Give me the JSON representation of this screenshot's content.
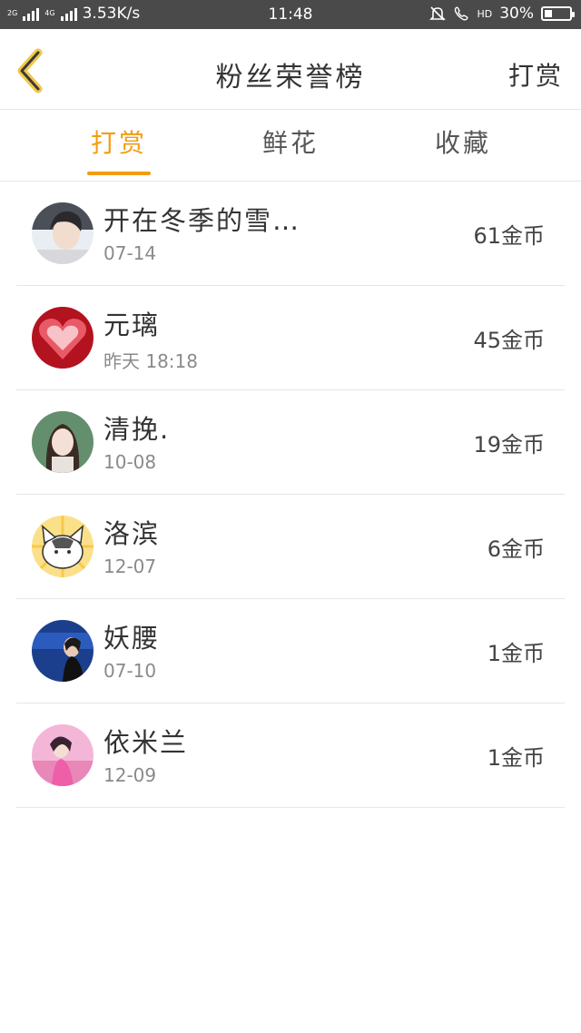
{
  "status_bar": {
    "network_left": "2G",
    "network_right": "4G",
    "speed": "3.53K/s",
    "time": "11:48",
    "hd_label": "HD",
    "battery": "30%",
    "battery_level": 0.3
  },
  "nav": {
    "title": "粉丝荣誉榜",
    "right_action": "打赏"
  },
  "tabs": [
    {
      "label": "打赏",
      "active": true
    },
    {
      "label": "鲜花",
      "active": false
    },
    {
      "label": "收藏",
      "active": false
    }
  ],
  "list": [
    {
      "name": "开在冬季的雪…",
      "date": "07-14",
      "coins": "61金币"
    },
    {
      "name": "元璃",
      "date": "昨天 18:18",
      "coins": "45金币"
    },
    {
      "name": "清挽.",
      "date": "10-08",
      "coins": "19金币"
    },
    {
      "name": "洛滨",
      "date": "12-07",
      "coins": "6金币"
    },
    {
      "name": "妖腰",
      "date": "07-10",
      "coins": "1金币"
    },
    {
      "name": "依米兰",
      "date": "12-09",
      "coins": "1金币"
    }
  ],
  "colors": {
    "accent": "#f39c12",
    "status_bar": "#4a4a4a",
    "divider": "#e6e6e6"
  }
}
